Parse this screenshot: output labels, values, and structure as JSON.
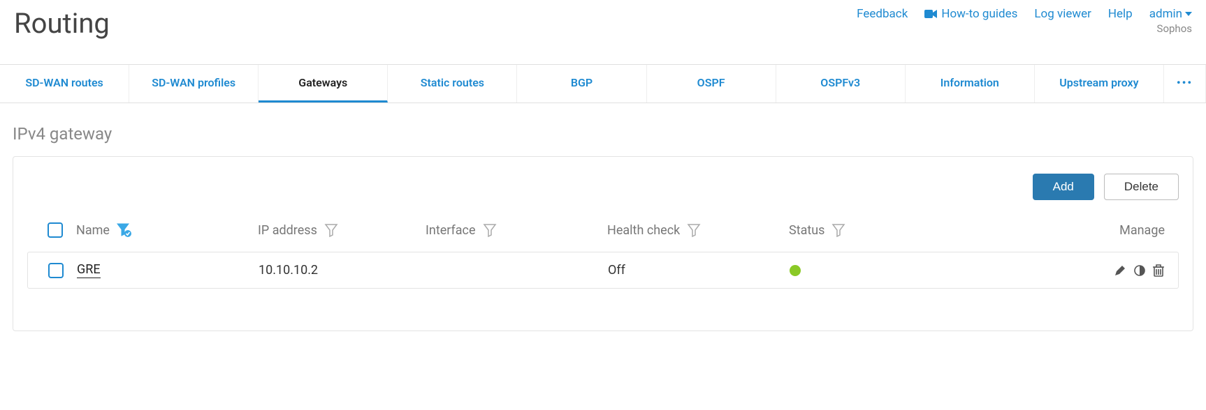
{
  "header": {
    "title": "Routing",
    "links": {
      "feedback": "Feedback",
      "howto": "How-to guides",
      "logviewer": "Log viewer",
      "help": "Help"
    },
    "user": {
      "name": "admin",
      "brand": "Sophos"
    }
  },
  "tabs": [
    {
      "label": "SD-WAN routes",
      "active": false
    },
    {
      "label": "SD-WAN profiles",
      "active": false
    },
    {
      "label": "Gateways",
      "active": true
    },
    {
      "label": "Static routes",
      "active": false
    },
    {
      "label": "BGP",
      "active": false
    },
    {
      "label": "OSPF",
      "active": false
    },
    {
      "label": "OSPFv3",
      "active": false
    },
    {
      "label": "Information",
      "active": false
    },
    {
      "label": "Upstream proxy",
      "active": false
    }
  ],
  "more_tab": "•••",
  "section_title": "IPv4 gateway",
  "buttons": {
    "add": "Add",
    "delete": "Delete"
  },
  "columns": {
    "name": "Name",
    "ip": "IP address",
    "interface": "Interface",
    "health": "Health check",
    "status": "Status",
    "manage": "Manage"
  },
  "rows": [
    {
      "name": "GRE",
      "ip": "10.10.10.2",
      "interface": "",
      "health": "Off",
      "status_color": "#8ac926"
    }
  ],
  "icons": {
    "camera": "camera-icon",
    "filter": "funnel-icon",
    "filter_active": "funnel-check-icon",
    "edit": "pencil-icon",
    "toggle": "circle-half-icon",
    "delete": "trash-icon",
    "caret": "caret-down-icon"
  },
  "colors": {
    "link": "#1f8ad1",
    "primary_button": "#2a7ab0",
    "status_on": "#8ac926"
  }
}
